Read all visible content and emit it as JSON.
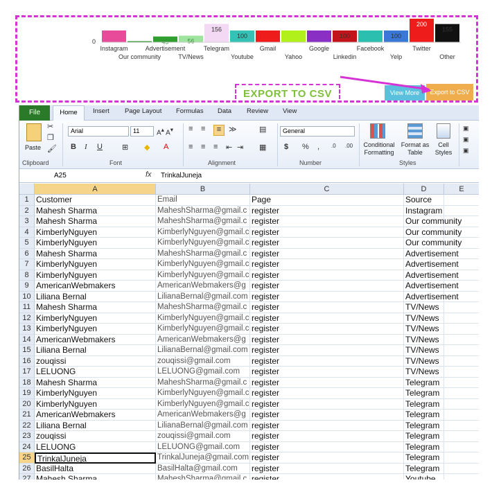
{
  "chart_data": {
    "type": "bar",
    "y_zero_label": "0",
    "categories": [
      "Instagram",
      "Our community",
      "Advertisement",
      "TV/News",
      "Telegram",
      "Youtube",
      "Gmail",
      "Yahoo",
      "Google",
      "Linkedin",
      "Facebook",
      "Yelp",
      "Twitter",
      "Other"
    ],
    "values": [
      100,
      9,
      49,
      56,
      156,
      100,
      100,
      100,
      100,
      100,
      100,
      100,
      200,
      155
    ],
    "data_labels": [
      "",
      "",
      "49",
      "56",
      "156",
      "100",
      "",
      "",
      "",
      "100",
      "",
      "100",
      "200",
      "155"
    ],
    "colors": [
      "#e84b9a",
      "#1a8f1a",
      "#2fa02f",
      "#9ee49e",
      "#f3d9f3",
      "#33c2b5",
      "#ef1c1c",
      "#b2f01b",
      "#8a2fc4",
      "#c4141b",
      "#2bbfb0",
      "#3a78d8",
      "#ef1c1c",
      "#111111",
      "#c9c9c9"
    ],
    "ylim": [
      0,
      200
    ]
  },
  "export_label": "EXPORT TO CSV",
  "view_more_label": "View More",
  "export_button_label": "Export to CSV",
  "excel": {
    "tabs": [
      "File",
      "Home",
      "Insert",
      "Page Layout",
      "Formulas",
      "Data",
      "Review",
      "View"
    ],
    "font_name": "Arial",
    "font_size": "11",
    "number_format": "General",
    "groups": [
      "Clipboard",
      "Font",
      "Alignment",
      "Number",
      "Styles"
    ],
    "paste_label": "Paste",
    "cond_format_label": "Conditional Formatting",
    "format_table_label": "Format as Table",
    "cell_styles_label": "Cell Styles",
    "name_box": "A25",
    "formula": "TrinkalJuneja",
    "columns": [
      "A",
      "B",
      "C",
      "D",
      "E"
    ],
    "rows": [
      {
        "n": "1",
        "a": "Customer",
        "b": "Email",
        "c": "Page",
        "d": "Source"
      },
      {
        "n": "2",
        "a": "Mahesh Sharma",
        "b": "MaheshSharma@gmail.c",
        "c": "register",
        "d": "Instagram"
      },
      {
        "n": "3",
        "a": "Mahesh Sharma",
        "b": "MaheshSharma@gmail.c",
        "c": "register",
        "d": "Our community"
      },
      {
        "n": "4",
        "a": "KimberlyNguyen",
        "b": "KimberlyNguyen@gmail.c",
        "c": "register",
        "d": "Our community"
      },
      {
        "n": "5",
        "a": "KimberlyNguyen",
        "b": "KimberlyNguyen@gmail.c",
        "c": "register",
        "d": "Our community"
      },
      {
        "n": "6",
        "a": "Mahesh Sharma",
        "b": "MaheshSharma@gmail.c",
        "c": "register",
        "d": "Advertisement"
      },
      {
        "n": "7",
        "a": "KimberlyNguyen",
        "b": "KimberlyNguyen@gmail.c",
        "c": "register",
        "d": "Advertisement"
      },
      {
        "n": "8",
        "a": "KimberlyNguyen",
        "b": "KimberlyNguyen@gmail.c",
        "c": "register",
        "d": "Advertisement"
      },
      {
        "n": "9",
        "a": "AmericanWebmakers",
        "b": "AmericanWebmakers@g",
        "c": "register",
        "d": "Advertisement"
      },
      {
        "n": "10",
        "a": "Liliana Bernal",
        "b": "LilianaBernal@gmail.com",
        "c": "register",
        "d": "Advertisement"
      },
      {
        "n": "11",
        "a": "Mahesh Sharma",
        "b": "MaheshSharma@gmail.c",
        "c": "register",
        "d": "TV/News"
      },
      {
        "n": "12",
        "a": "KimberlyNguyen",
        "b": "KimberlyNguyen@gmail.c",
        "c": "register",
        "d": "TV/News"
      },
      {
        "n": "13",
        "a": "KimberlyNguyen",
        "b": "KimberlyNguyen@gmail.c",
        "c": "register",
        "d": "TV/News"
      },
      {
        "n": "14",
        "a": "AmericanWebmakers",
        "b": "AmericanWebmakers@g",
        "c": "register",
        "d": "TV/News"
      },
      {
        "n": "15",
        "a": "Liliana Bernal",
        "b": "LilianaBernal@gmail.com",
        "c": "register",
        "d": "TV/News"
      },
      {
        "n": "16",
        "a": "zouqissi",
        "b": "zouqissi@gmail.com",
        "c": "register",
        "d": "TV/News"
      },
      {
        "n": "17",
        "a": "LELUONG",
        "b": "LELUONG@gmail.com",
        "c": "register",
        "d": "TV/News"
      },
      {
        "n": "18",
        "a": "Mahesh Sharma",
        "b": "MaheshSharma@gmail.c",
        "c": "register",
        "d": "Telegram"
      },
      {
        "n": "19",
        "a": "KimberlyNguyen",
        "b": "KimberlyNguyen@gmail.c",
        "c": "register",
        "d": "Telegram"
      },
      {
        "n": "20",
        "a": "KimberlyNguyen",
        "b": "KimberlyNguyen@gmail.c",
        "c": "register",
        "d": "Telegram"
      },
      {
        "n": "21",
        "a": "AmericanWebmakers",
        "b": "AmericanWebmakers@g",
        "c": "register",
        "d": "Telegram"
      },
      {
        "n": "22",
        "a": "Liliana Bernal",
        "b": "LilianaBernal@gmail.com",
        "c": "register",
        "d": "Telegram"
      },
      {
        "n": "23",
        "a": "zouqissi",
        "b": "zouqissi@gmail.com",
        "c": "register",
        "d": "Telegram"
      },
      {
        "n": "24",
        "a": "LELUONG",
        "b": "LELUONG@gmail.com",
        "c": "register",
        "d": "Telegram"
      },
      {
        "n": "25",
        "a": "TrinkalJuneja",
        "b": "TrinkalJuneja@gmail.com",
        "c": "register",
        "d": "Telegram"
      },
      {
        "n": "26",
        "a": "BasilHalta",
        "b": "BasilHalta@gmail.com",
        "c": "register",
        "d": "Telegram"
      },
      {
        "n": "27",
        "a": "Mahesh Sharma",
        "b": "MaheshSharma@gmail.c",
        "c": "register",
        "d": "Youtube"
      }
    ],
    "active_row": "25"
  }
}
